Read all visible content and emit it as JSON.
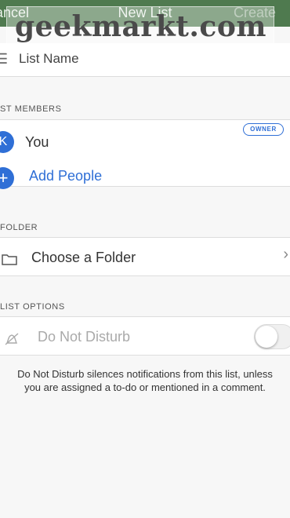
{
  "header": {
    "left_label": "ancel",
    "title": "New List",
    "right_label": "Create"
  },
  "watermark": {
    "text": "geekmarkt.com"
  },
  "list_name": {
    "label": "List Name"
  },
  "sections": {
    "members_title": "ST MEMBERS",
    "folder_title": "FOLDER",
    "options_title": "LIST OPTIONS"
  },
  "members": {
    "avatar_initial": "K",
    "you_label": "You",
    "owner_badge": "OWNER",
    "add_people_label": "Add People"
  },
  "folder": {
    "choose_label": "Choose a Folder"
  },
  "options": {
    "do_not_disturb_label": "Do Not Disturb",
    "do_not_disturb_enabled": false
  },
  "footnote": {
    "line1": "Do Not Disturb silences notifications from this list, unless",
    "line2": "you are assigned a to-do or mentioned in a comment."
  },
  "colors": {
    "header_bg": "#4f7a4f",
    "accent": "#2f6fd6",
    "background": "#f7f7f7"
  }
}
